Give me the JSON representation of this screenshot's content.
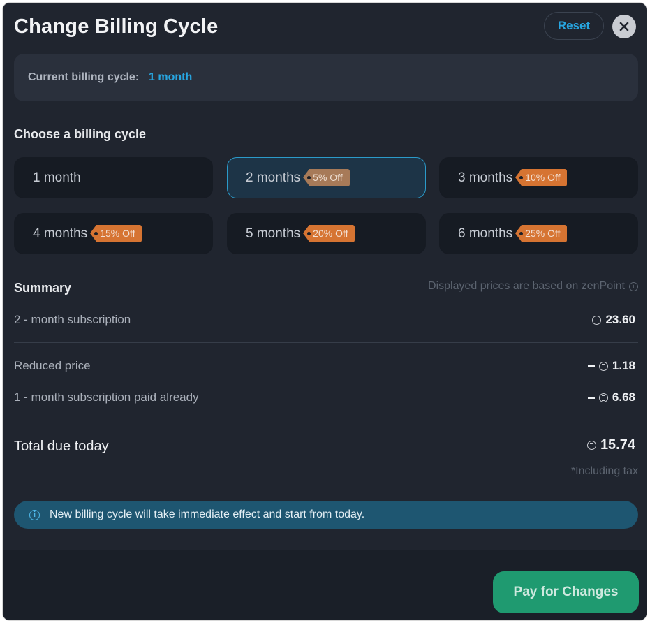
{
  "dialog": {
    "title": "Change Billing Cycle",
    "reset_label": "Reset",
    "close_icon": "close-icon"
  },
  "current": {
    "label": "Current billing cycle:",
    "value": "1 month"
  },
  "choose_heading": "Choose a billing cycle",
  "options": [
    {
      "label": "1 month",
      "badge": "",
      "selected": false
    },
    {
      "label": "2 months",
      "badge": "5% Off",
      "selected": true
    },
    {
      "label": "3 months",
      "badge": "10% Off",
      "selected": false
    },
    {
      "label": "4 months",
      "badge": "15% Off",
      "selected": false
    },
    {
      "label": "5 months",
      "badge": "20% Off",
      "selected": false
    },
    {
      "label": "6 months",
      "badge": "25% Off",
      "selected": false
    }
  ],
  "summary": {
    "heading": "Summary",
    "disclaimer": "Displayed prices are based on zenPoint",
    "subscription_label": "2 - month subscription",
    "subscription_value": "23.60",
    "reduced_label": "Reduced price",
    "reduced_value": "1.18",
    "paid_label": "1 - month subscription paid already",
    "paid_value": "6.68",
    "total_label": "Total due today",
    "total_value": "15.74",
    "tax_note": "*Including tax"
  },
  "banner": {
    "icon": "info-icon",
    "text": "New billing cycle will take immediate effect and start from today."
  },
  "footer": {
    "pay_label": "Pay for Changes"
  },
  "colors": {
    "accent": "#27a5e0",
    "badge": "#d67432",
    "pay_button": "#1f9a70",
    "background": "#20252f"
  }
}
